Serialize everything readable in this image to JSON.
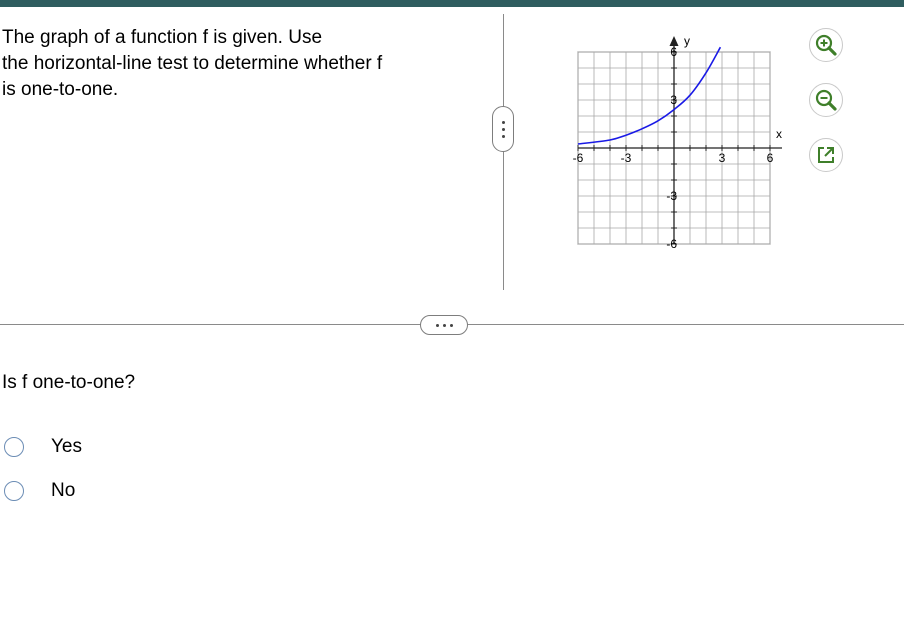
{
  "problem": {
    "prompt": "The graph of a function f is given.  Use\nthe horizontal-line test to determine whether f\nis one-to-one."
  },
  "graph": {
    "x_axis_label": "x",
    "y_axis_label": "y",
    "x_tick_labels": [
      "-6",
      "-3",
      "3",
      "6"
    ],
    "y_tick_labels": [
      "6",
      "3",
      "-3",
      "-6"
    ],
    "x_range": [
      -6,
      6
    ],
    "y_range": [
      -6,
      6
    ],
    "grid": true,
    "curve_color": "#1a1ae6",
    "curve_points": [
      [
        -6,
        0.25
      ],
      [
        -4,
        0.5
      ],
      [
        -3,
        0.8
      ],
      [
        -2,
        1.2
      ],
      [
        -1,
        1.7
      ],
      [
        0,
        2.4
      ],
      [
        1,
        3.3
      ],
      [
        2,
        4.7
      ],
      [
        2.9,
        6.3
      ]
    ]
  },
  "tools": {
    "zoom_in_icon": "zoom-in",
    "zoom_out_icon": "zoom-out",
    "popout_icon": "external-window"
  },
  "question": {
    "text": "Is f one-to-one?",
    "options": [
      "Yes",
      "No"
    ]
  },
  "colors": {
    "top_bar": "#2f5d5f",
    "radio_border": "#6c8db5",
    "tool_icon_fill": "#3f7f2a"
  }
}
